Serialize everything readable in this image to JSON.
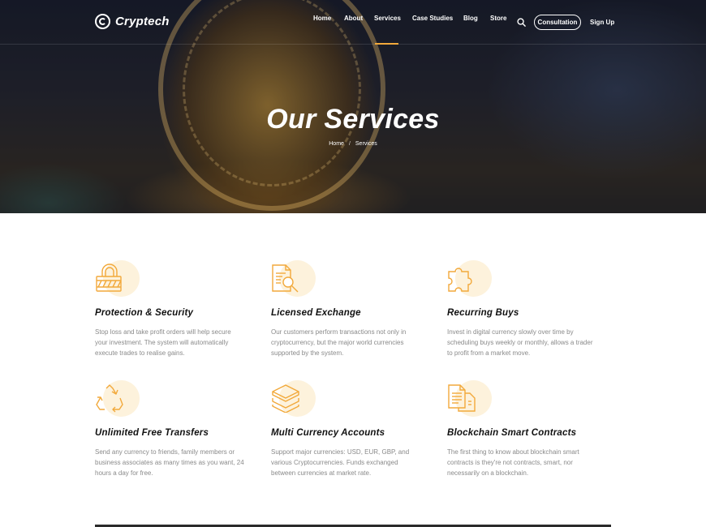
{
  "brand": {
    "name": "Cryptech"
  },
  "nav": {
    "items": [
      {
        "label": "Home"
      },
      {
        "label": "About"
      },
      {
        "label": "Services",
        "active": true
      },
      {
        "label": "Case Studies"
      },
      {
        "label": "Blog"
      },
      {
        "label": "Store"
      }
    ],
    "search_icon": "search-icon",
    "cta_label": "Consultation",
    "signup_label": "Sign Up"
  },
  "hero": {
    "title": "Our Services",
    "breadcrumb": {
      "home": "Home",
      "separator": "/",
      "current": "Services"
    }
  },
  "services": [
    {
      "icon": "lock-icon",
      "title": "Protection & Security",
      "description": "Stop loss and take profit orders will help secure your investment. The system will automatically execute trades to realise gains."
    },
    {
      "icon": "document-search-icon",
      "title": "Licensed Exchange",
      "description": "Our customers perform transactions not only in cryptocurrency, but the major world currencies supported by the system."
    },
    {
      "icon": "puzzle-icon",
      "title": "Recurring Buys",
      "description": "Invest in digital currency slowly over time by scheduling buys weekly or monthly, allows a trader to profit from a market move."
    },
    {
      "icon": "recycle-icon",
      "title": "Unlimited Free Transfers",
      "description": "Send any currency to friends, family members or business associates as many times as you want, 24 hours a day for free."
    },
    {
      "icon": "layers-icon",
      "title": "Multi Currency Accounts",
      "description": "Support major currencies: USD, EUR, GBP, and various Cryptocurrencies. Funds exchanged between currencies at market rate."
    },
    {
      "icon": "documents-icon",
      "title": "Blockchain Smart Contracts",
      "description": "The first thing to know about blockchain smart contracts is they're not contracts, smart, nor necessarily on a blockchain."
    }
  ],
  "colors": {
    "accent": "#f2a93b",
    "icon_bg": "#fdf2dc",
    "text_muted": "#8a8a8a"
  }
}
